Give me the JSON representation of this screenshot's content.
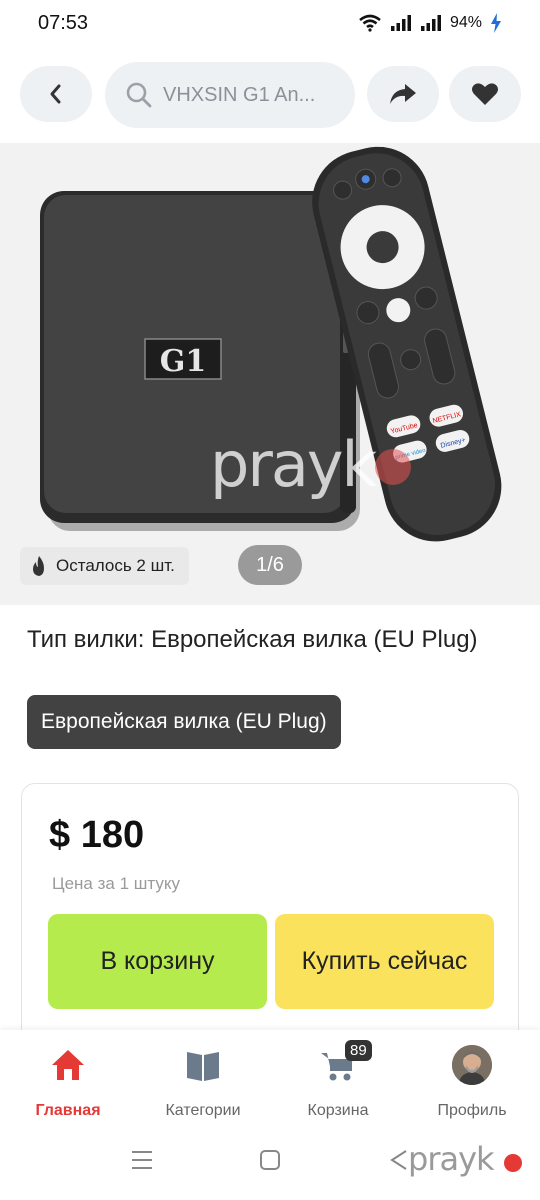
{
  "status_bar": {
    "time": "07:53",
    "battery": "94%"
  },
  "top_nav": {
    "search_text": "VHXSIN G1 An..."
  },
  "gallery": {
    "stock_text": "Осталось 2 шт.",
    "counter": "1/6",
    "device_label": "G1",
    "watermark": "prayk",
    "remote_labels": [
      "YouTube",
      "NETFLIX",
      "prime video",
      "Disney+"
    ]
  },
  "variant": {
    "title": "Тип вилки: Европейская вилка (EU Plug)",
    "selected": "Европейская вилка (EU Plug)"
  },
  "price_card": {
    "price": "$ 180",
    "price_note": "Цена за 1 штуку",
    "add_to_cart": "В корзину",
    "buy_now": "Купить сейчас"
  },
  "tab_bar": {
    "home": "Главная",
    "categories": "Категории",
    "cart": "Корзина",
    "cart_count": "89",
    "profile": "Профиль",
    "active_color": "#e53935"
  },
  "system_nav": {
    "watermark": "prayk"
  }
}
